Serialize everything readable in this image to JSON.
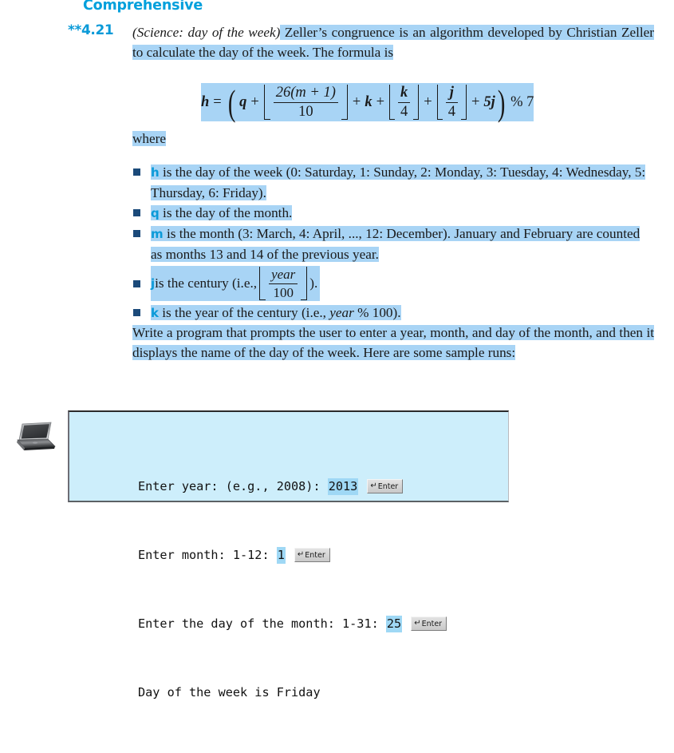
{
  "section": {
    "heading": "Comprehensive"
  },
  "exercise": {
    "number": "**4.21",
    "title_italic": "(Science: day of the week)",
    "intro_text": " Zeller’s congruence is an algorithm developed by Christian Zeller to calculate the day of the week. The formula is",
    "where_label": "where"
  },
  "formula": {
    "lhs": "h",
    "equals": "=",
    "open_paren": "(",
    "q": "q",
    "plus1": "+",
    "frac1_num": "26(m + 1)",
    "frac1_den": "10",
    "plus2": "+",
    "k": "k",
    "plus3": "+",
    "frac2_num": "k",
    "frac2_den": "4",
    "plus4": "+",
    "frac3_num": "j",
    "frac3_den": "4",
    "plus5": "+",
    "term_5j": "5j",
    "close_paren": ")",
    "mod": "% 7"
  },
  "definitions": [
    {
      "var": "h",
      "text": " is the day of the week (0: Saturday, 1: Sunday, 2: Monday, 3: Tuesday, 4:  Wednesday, 5: Thursday, 6: Friday)."
    },
    {
      "var": "q",
      "text": " is the day of the month."
    },
    {
      "var": "m",
      "text": " is the month (3: March, 4: April, ..., 12: December). January and February are counted as months 13 and 14 of the previous year."
    },
    {
      "var": "j",
      "text_before": " is the century (i.e.,",
      "frac_num": "year",
      "frac_den": "100",
      "text_after": ")."
    },
    {
      "var": "k",
      "text_before": " is the year of the century (i.e., ",
      "italic_part": "year",
      "text_after": " % 100)."
    }
  ],
  "closing_paragraph": "Write a program that prompts the user to enter a year, month, and day of the month, and then it displays the name of the day of the week. Here are some sample runs:",
  "console": {
    "icon_name": "laptop-icon",
    "lines": [
      {
        "prompt": "Enter year: (e.g., 2008): ",
        "value": "2013",
        "enter_label": "Enter",
        "enter_glyph": "↵"
      },
      {
        "prompt": "Enter month: 1-12: ",
        "value": "1",
        "enter_label": "Enter",
        "enter_glyph": "↵"
      },
      {
        "prompt": "Enter the day of the month: 1-31: ",
        "value": "25",
        "enter_label": "Enter",
        "enter_glyph": "↵"
      },
      {
        "prompt": "Day of the week is Friday",
        "value": "",
        "enter_label": "",
        "enter_glyph": ""
      }
    ]
  },
  "colors": {
    "heading": "#00a0dc",
    "accent_variable": "#0a9ad8",
    "highlight": "#a8d4f5",
    "bullet_square": "#1b4a7a",
    "console_bg": "#cdeefb",
    "console_value_highlight": "#9fd8f5"
  }
}
